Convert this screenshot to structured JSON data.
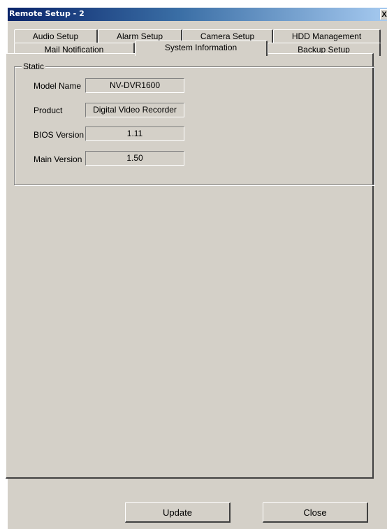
{
  "window": {
    "title": "Remote Setup - 2",
    "close_label": "X"
  },
  "tabs": {
    "row1": [
      {
        "label": "Audio Setup"
      },
      {
        "label": "Alarm Setup"
      },
      {
        "label": "Camera Setup"
      },
      {
        "label": "HDD Management"
      }
    ],
    "row2": [
      {
        "label": "Mail Notification"
      },
      {
        "label": "System Information",
        "active": true
      },
      {
        "label": "Backup Setup"
      }
    ]
  },
  "static_group": {
    "legend": "Static",
    "fields": [
      {
        "label": "Model Name",
        "value": "NV-DVR1600"
      },
      {
        "label": "Product",
        "value": "Digital Video Recorder"
      },
      {
        "label": "BIOS Version",
        "value": "1.11"
      },
      {
        "label": "Main Version",
        "value": "1.50"
      }
    ]
  },
  "buttons": {
    "update": "Update",
    "close": "Close"
  }
}
